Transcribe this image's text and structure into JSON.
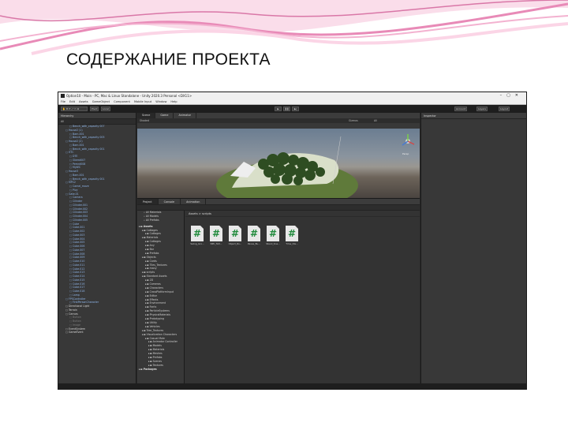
{
  "slide": {
    "title": "СОДЕРЖАНИЕ ПРОЕКТА"
  },
  "window": {
    "title": "Option10 - Main - PC, Mac & Linux Standalone - Unity 2020.3 Personal <DX11>",
    "menu": [
      "File",
      "Edit",
      "Assets",
      "GameObject",
      "Component",
      "Mobile Input",
      "Window",
      "Help"
    ]
  },
  "toolbar": {
    "pivot": "Pivot",
    "local": "Local",
    "account": "Account",
    "layers": "Layers",
    "layout": "Layout"
  },
  "hierarchy": {
    "title": "Hierarchy",
    "search_placeholder": "All",
    "items": [
      {
        "label": "Bench_with_capacity 007",
        "indent": 2,
        "tone": "blue"
      },
      {
        "label": "House2 (1)",
        "indent": 1,
        "tone": "blue"
      },
      {
        "label": "Barn.001",
        "indent": 2,
        "tone": "blue"
      },
      {
        "label": "Bench_with_capacity 005",
        "indent": 2,
        "tone": "blue"
      },
      {
        "label": "House2 (2)",
        "indent": 1,
        "tone": "blue"
      },
      {
        "label": "Barn.001",
        "indent": 2,
        "tone": "blue"
      },
      {
        "label": "Bench_with_capacity 001",
        "indent": 2,
        "tone": "blue"
      },
      {
        "label": "HTC",
        "indent": 1,
        "tone": "blue"
      },
      {
        "label": "DTE",
        "indent": 2,
        "tone": "blue"
      },
      {
        "label": "Gtemt007",
        "indent": 2,
        "tone": "blue"
      },
      {
        "label": "Pemnt008",
        "indent": 2,
        "tone": "blue"
      },
      {
        "label": "MyWC",
        "indent": 2,
        "tone": "blue"
      },
      {
        "label": "House3",
        "indent": 1,
        "tone": "blue"
      },
      {
        "label": "Barn.001",
        "indent": 2,
        "tone": "blue"
      },
      {
        "label": "Bench_with_capacity 001",
        "indent": 2,
        "tone": "blue"
      },
      {
        "label": "MPC2",
        "indent": 1,
        "tone": "blue"
      },
      {
        "label": "Camel_move",
        "indent": 2,
        "tone": "blue"
      },
      {
        "label": "Pivy",
        "indent": 2,
        "tone": "blue"
      },
      {
        "label": "Gate.01",
        "indent": 1,
        "tone": "blue"
      },
      {
        "label": "Camera",
        "indent": 2,
        "tone": "blue"
      },
      {
        "label": "Cilinder",
        "indent": 2,
        "tone": "blue"
      },
      {
        "label": "Cilinder.001",
        "indent": 2,
        "tone": "blue"
      },
      {
        "label": "Cilinder.002",
        "indent": 2,
        "tone": "blue"
      },
      {
        "label": "Cilinder.003",
        "indent": 2,
        "tone": "blue"
      },
      {
        "label": "Cilinder.004",
        "indent": 2,
        "tone": "blue"
      },
      {
        "label": "Cilinder.005",
        "indent": 2,
        "tone": "blue"
      },
      {
        "label": "Cube",
        "indent": 2,
        "tone": "blue"
      },
      {
        "label": "Cube.001",
        "indent": 2,
        "tone": "blue"
      },
      {
        "label": "Cube.002",
        "indent": 2,
        "tone": "blue"
      },
      {
        "label": "Cube.003",
        "indent": 2,
        "tone": "blue"
      },
      {
        "label": "Cube.004",
        "indent": 2,
        "tone": "blue"
      },
      {
        "label": "Cube.005",
        "indent": 2,
        "tone": "blue"
      },
      {
        "label": "Cube.006",
        "indent": 2,
        "tone": "blue"
      },
      {
        "label": "Cube.007",
        "indent": 2,
        "tone": "blue"
      },
      {
        "label": "Cube.008",
        "indent": 2,
        "tone": "blue"
      },
      {
        "label": "Cube.009",
        "indent": 2,
        "tone": "blue"
      },
      {
        "label": "Cube.010",
        "indent": 2,
        "tone": "blue"
      },
      {
        "label": "Cube.011",
        "indent": 2,
        "tone": "blue"
      },
      {
        "label": "Cube.012",
        "indent": 2,
        "tone": "blue"
      },
      {
        "label": "Cube.013",
        "indent": 2,
        "tone": "blue"
      },
      {
        "label": "Cube.014",
        "indent": 2,
        "tone": "blue"
      },
      {
        "label": "Cube.015",
        "indent": 2,
        "tone": "blue"
      },
      {
        "label": "Cube.016",
        "indent": 2,
        "tone": "blue"
      },
      {
        "label": "Cube.017",
        "indent": 2,
        "tone": "blue"
      },
      {
        "label": "Cube.018",
        "indent": 2,
        "tone": "blue"
      },
      {
        "label": "Lamp",
        "indent": 2,
        "tone": "blue"
      },
      {
        "label": "FPSController",
        "indent": 1,
        "tone": "blue"
      },
      {
        "label": "FirstPersonCharacter",
        "indent": 2,
        "tone": "blue"
      },
      {
        "label": "Directional Light",
        "indent": 1,
        "tone": "white"
      },
      {
        "label": "Terrain",
        "indent": 1,
        "tone": "white"
      },
      {
        "label": "Canvas",
        "indent": 1,
        "tone": "white"
      },
      {
        "label": "Button",
        "indent": 2,
        "tone": "grey"
      },
      {
        "label": "Button",
        "indent": 2,
        "tone": "grey"
      },
      {
        "label": "Image",
        "indent": 2,
        "tone": "grey"
      },
      {
        "label": "EventSystem",
        "indent": 1,
        "tone": "white"
      },
      {
        "label": "GameEvent",
        "indent": 1,
        "tone": "white"
      }
    ]
  },
  "scene": {
    "tabs": [
      "Scene",
      "Game",
      "Animator"
    ],
    "shading": "Shaded",
    "gizmos": "Gizmos",
    "search": "All",
    "persp": "Persp"
  },
  "project": {
    "tabs": [
      "Project",
      "Console",
      "Animation"
    ],
    "favorites": [
      "All Materials",
      "All Models",
      "All Prefabs"
    ],
    "tree": [
      {
        "label": "Assets",
        "indent": 0,
        "bold": true
      },
      {
        "label": "Cottages",
        "indent": 1
      },
      {
        "label": "Cottages",
        "indent": 2
      },
      {
        "label": "Materials",
        "indent": 1
      },
      {
        "label": "Cottages",
        "indent": 2
      },
      {
        "label": "Any",
        "indent": 2
      },
      {
        "label": "Bar",
        "indent": 2
      },
      {
        "label": "Prefabs",
        "indent": 2
      },
      {
        "label": "Objects",
        "indent": 1
      },
      {
        "label": "Cards",
        "indent": 2
      },
      {
        "label": "Tiles_Textures",
        "indent": 2
      },
      {
        "label": "many",
        "indent": 2
      },
      {
        "label": "scripts",
        "indent": 1
      },
      {
        "label": "Standard Assets",
        "indent": 1
      },
      {
        "label": "2D",
        "indent": 2
      },
      {
        "label": "Cameras",
        "indent": 2
      },
      {
        "label": "Characters",
        "indent": 2
      },
      {
        "label": "CrossPlatformInput",
        "indent": 2
      },
      {
        "label": "Editor",
        "indent": 2
      },
      {
        "label": "Effects",
        "indent": 2
      },
      {
        "label": "Environment",
        "indent": 2
      },
      {
        "label": "Fonts",
        "indent": 2
      },
      {
        "label": "ParticleSystems",
        "indent": 2
      },
      {
        "label": "PhysicsMaterials",
        "indent": 2
      },
      {
        "label": "Prototyping",
        "indent": 2
      },
      {
        "label": "Utility",
        "indent": 2
      },
      {
        "label": "Vehicles",
        "indent": 2
      },
      {
        "label": "Tree_Textures",
        "indent": 1
      },
      {
        "label": "Visualization Characters",
        "indent": 1
      },
      {
        "label": "Casual Male",
        "indent": 2
      },
      {
        "label": "Animator Controller",
        "indent": 3
      },
      {
        "label": "Models",
        "indent": 3
      },
      {
        "label": "Materials",
        "indent": 3
      },
      {
        "label": "Meshes",
        "indent": 3
      },
      {
        "label": "Prefabs",
        "indent": 3
      },
      {
        "label": "Scenes",
        "indent": 3
      },
      {
        "label": "Textures",
        "indent": 3
      },
      {
        "label": "Packages",
        "indent": 0,
        "bold": true
      }
    ],
    "breadcrumb": "Assets > scripts",
    "files": [
      "Swing_Gro...",
      "NPC_Tetr...",
      "Object_Ro...",
      "Pause_Bu...",
      "Stand_Sna...",
      "Time_Dis..."
    ]
  },
  "inspector": {
    "title": "Inspector"
  }
}
